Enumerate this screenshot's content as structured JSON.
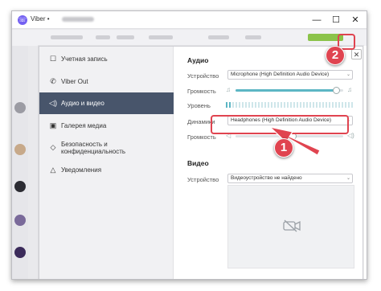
{
  "window": {
    "title": "Viber •",
    "minimize_glyph": "—",
    "maximize_glyph": "☐",
    "close_glyph": "✕"
  },
  "dialog_close_glyph": "✕",
  "nav": [
    {
      "label": "Учетная запись",
      "icon": "user-icon",
      "glyph": "☐",
      "active": false
    },
    {
      "label": "Viber Out",
      "icon": "phone-icon",
      "glyph": "✆",
      "active": false
    },
    {
      "label": "Аудио и видео",
      "icon": "speaker-icon",
      "glyph": "◁)",
      "active": true
    },
    {
      "label": "Галерея медиа",
      "icon": "gallery-icon",
      "glyph": "▣",
      "active": false
    },
    {
      "label": "Безопасность и конфиденциальность",
      "icon": "shield-icon",
      "glyph": "◇",
      "active": false
    },
    {
      "label": "Уведомления",
      "icon": "bell-icon",
      "glyph": "△",
      "active": false
    }
  ],
  "audio": {
    "title": "Аудио",
    "device_label": "Устройство",
    "device_value": "Microphone (High Definition Audio Device)",
    "mic_volume_label": "Громкость",
    "mic_volume": 0.93,
    "level_label": "Уровень",
    "level": 0.03,
    "speakers_label": "Динамики",
    "speakers_value": "Headphones (High Definition Audio Device)",
    "speaker_volume_label": "Громкость",
    "speaker_volume": 0.53
  },
  "video": {
    "title": "Видео",
    "device_label": "Устройство",
    "device_value": "Видеоустройство не найдено"
  },
  "annotations": {
    "step1": "1",
    "step2": "2",
    "color": "#e04450"
  },
  "colors": {
    "accent": "#7360f2",
    "nav_active": "#48556b",
    "slider": "#5cb6c4"
  }
}
